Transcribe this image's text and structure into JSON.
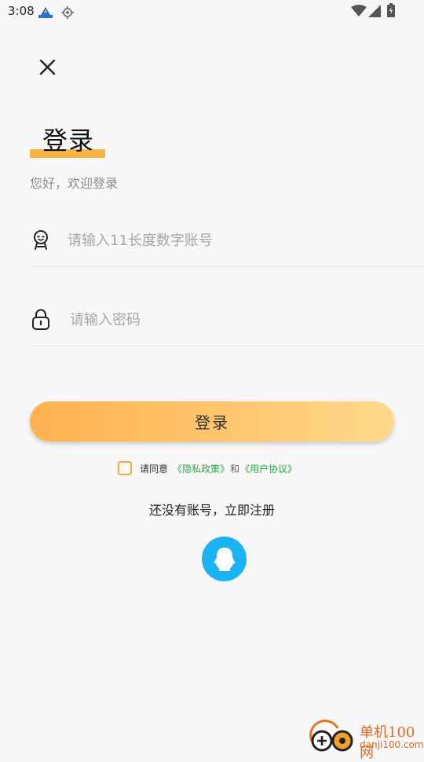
{
  "status_bar": {
    "time": "3:08",
    "icons": [
      "app-notification-icon",
      "location-icon",
      "wifi-icon",
      "cell-signal-icon",
      "battery-icon"
    ]
  },
  "login": {
    "title": "登录",
    "subtitle": "您好，欢迎登录",
    "account_placeholder": "请输入11长度数字账号",
    "account_value": "",
    "password_placeholder": "请输入密码",
    "password_value": "",
    "login_button": "登录",
    "agree_prefix": "请同意",
    "privacy_link": "《隐私政策》",
    "agree_and": "和",
    "terms_link": "《用户协议》",
    "agreement_checked": false,
    "register_text": "还没有账号，立即注册"
  },
  "colors": {
    "accent": "#f6b444",
    "button_start": "#ffb14f",
    "button_end": "#ffda8c",
    "link": "#2aa84a",
    "qq": "#1bb4f2",
    "background": "#f7f7f7"
  },
  "watermark": {
    "name": "单机100网",
    "domain": "danji100.com"
  }
}
